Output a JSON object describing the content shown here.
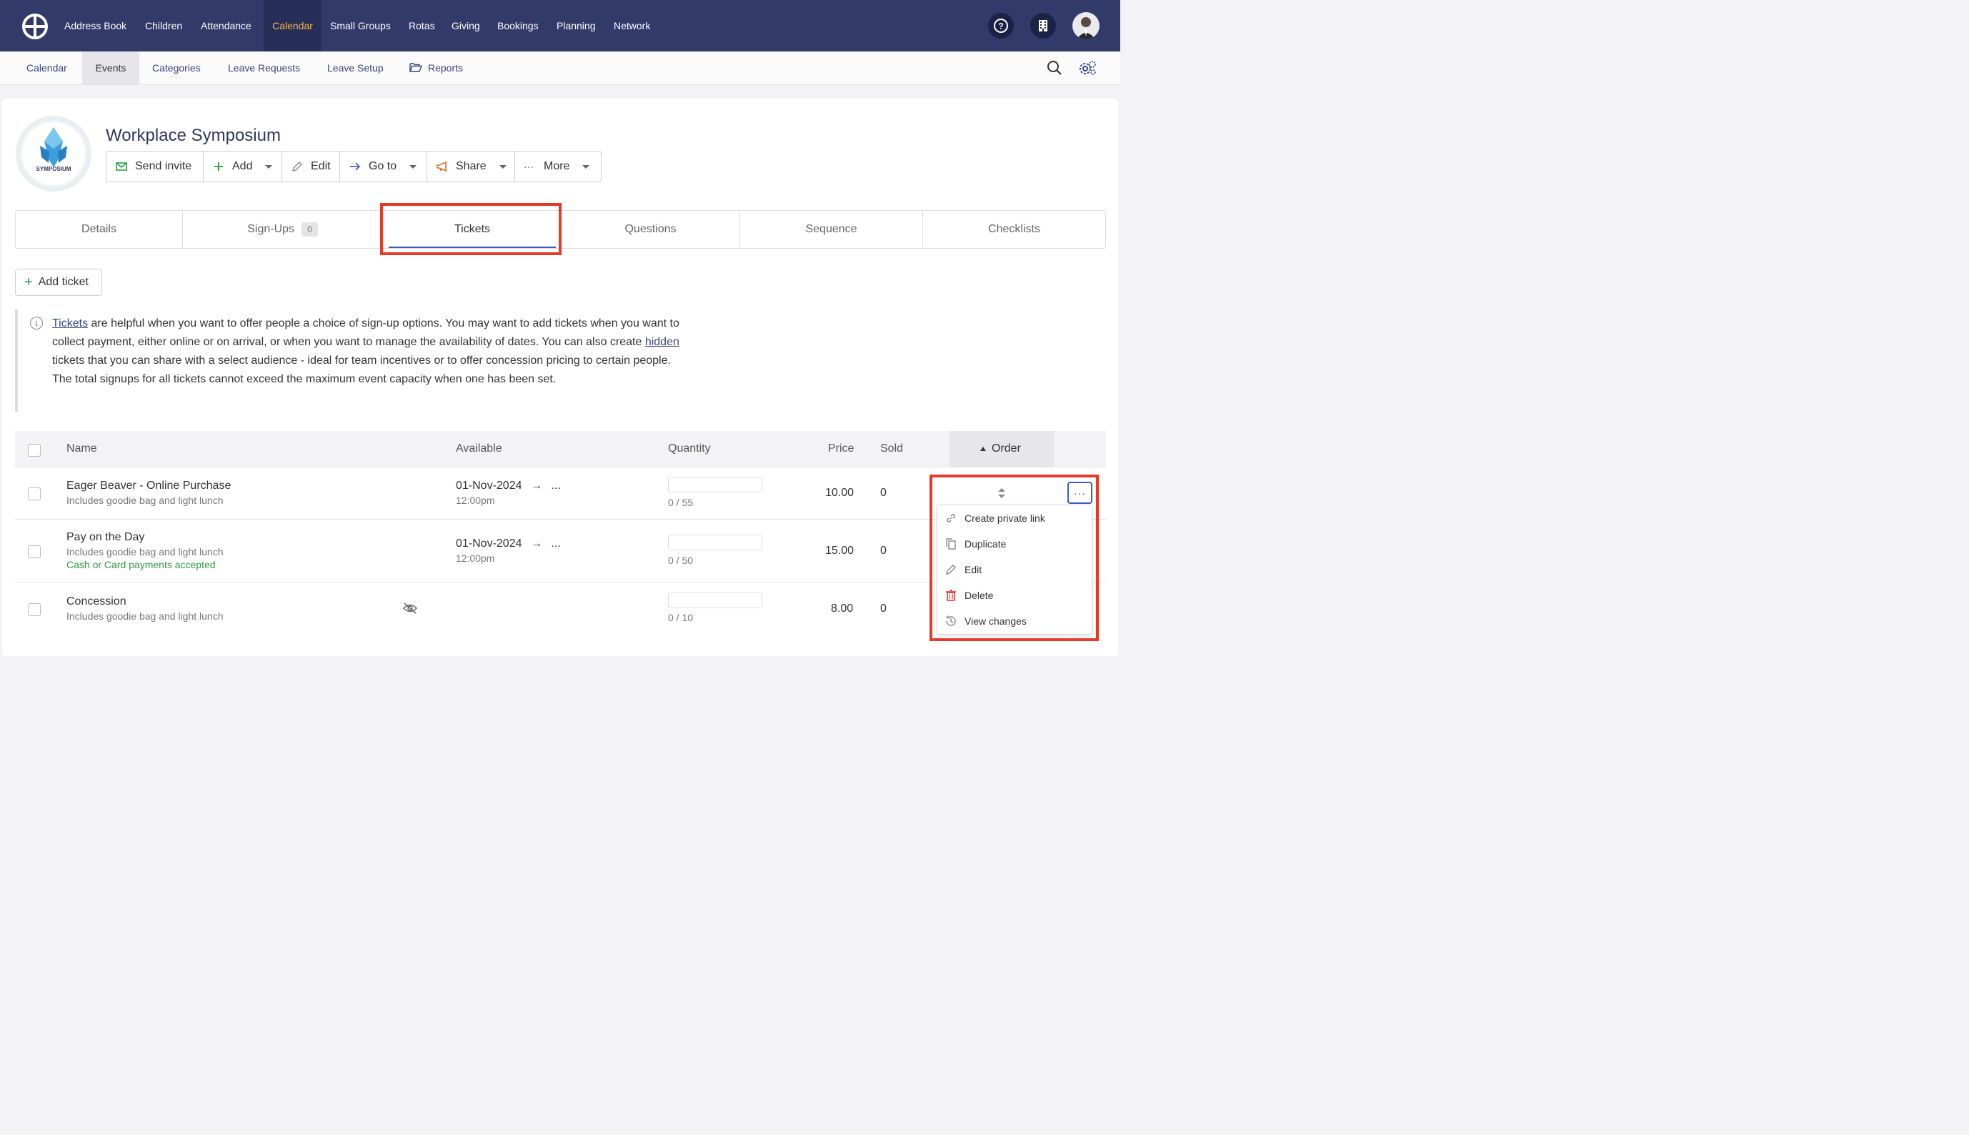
{
  "topnav": {
    "items": [
      "Address Book",
      "Children",
      "Attendance",
      "Calendar",
      "Small Groups",
      "Rotas",
      "Giving",
      "Bookings",
      "Planning",
      "Network"
    ],
    "active": "Calendar",
    "help_icon": "question-circle-icon",
    "org_icon": "building-icon",
    "avatar_icon": "user-avatar"
  },
  "subnav": {
    "items": [
      "Calendar",
      "Events",
      "Categories",
      "Leave Requests",
      "Leave Setup",
      "Reports"
    ],
    "active": "Events",
    "reports_icon": "folder-open-icon",
    "search_icon": "search-icon",
    "settings_icon": "gears-icon"
  },
  "event": {
    "logo_text": "SYMPOSIUM",
    "title": "Workplace Symposium"
  },
  "actions": {
    "send_invite": "Send invite",
    "add": "Add",
    "edit": "Edit",
    "go_to": "Go to",
    "share": "Share",
    "more": "More"
  },
  "tabs": {
    "details": "Details",
    "signups": "Sign-Ups",
    "signups_count": "0",
    "tickets": "Tickets",
    "questions": "Questions",
    "sequence": "Sequence",
    "checklists": "Checklists"
  },
  "add_ticket": "Add ticket",
  "info": {
    "link1": "Tickets",
    "text1": " are helpful when you want to offer people a choice of sign-up options. You may want to add tickets when you want to collect payment, either online or on arrival, or when you want to manage the availability of dates. You can also create ",
    "link2": "hidden",
    "text2": " tickets that you can share with a select audience - ideal for team incentives or to offer concession pricing to certain people. The total signups for all tickets cannot exceed the maximum event capacity when one has been set."
  },
  "table": {
    "headers": {
      "name": "Name",
      "available": "Available",
      "quantity": "Quantity",
      "price": "Price",
      "sold": "Sold",
      "order": "Order"
    },
    "rows": [
      {
        "name": "Eager Beaver - Online Purchase",
        "desc": "Includes goodie bag and light lunch",
        "note": "",
        "date": "01-Nov-2024",
        "time": "12:00pm",
        "arrow": "→",
        "ellipsis": "...",
        "qty": "0 / 55",
        "price": "10.00",
        "sold": "0"
      },
      {
        "name": "Pay on the Day",
        "desc": "Includes goodie bag and light lunch",
        "note": "Cash or Card payments accepted",
        "date": "01-Nov-2024",
        "time": "12:00pm",
        "arrow": "→",
        "ellipsis": "...",
        "qty": "0 / 50",
        "price": "15.00",
        "sold": "0"
      },
      {
        "name": "Concession",
        "desc": "Includes goodie bag and light lunch",
        "note": "",
        "hidden_icon": "eye-slash-icon",
        "qty": "0 / 10",
        "price": "8.00",
        "sold": "0"
      }
    ]
  },
  "dropdown": {
    "items": [
      "Create private link",
      "Duplicate",
      "Edit",
      "Delete",
      "View changes"
    ]
  },
  "colors": {
    "nav_bg": "#323a6a",
    "nav_active": "#f2b94a",
    "link": "#38467e",
    "highlight": "#e53a28",
    "green": "#2f9a44",
    "delete": "#d9342b"
  }
}
